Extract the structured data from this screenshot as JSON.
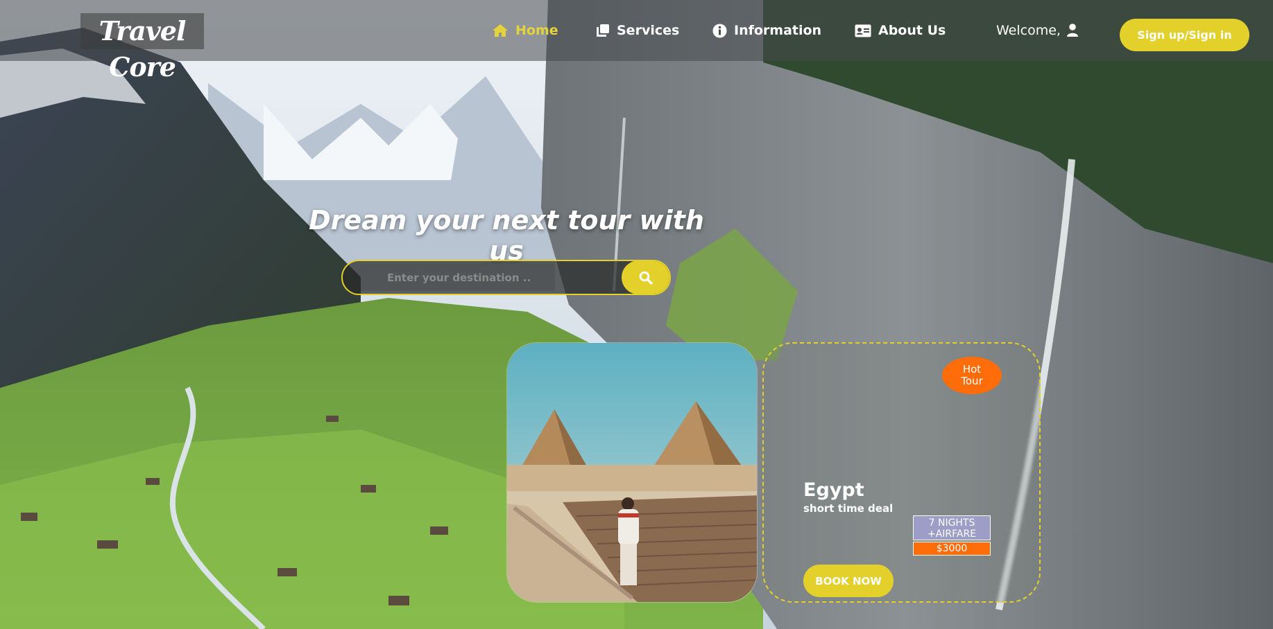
{
  "brand": {
    "logo_text": "Travel Core"
  },
  "nav": {
    "items": [
      {
        "label": "Home",
        "icon": "home-icon",
        "active": true
      },
      {
        "label": "Services",
        "icon": "copy-icon",
        "active": false
      },
      {
        "label": "Information",
        "icon": "info-circle-icon",
        "active": false
      },
      {
        "label": "About Us",
        "icon": "id-card-icon",
        "active": false
      }
    ],
    "welcome_text": "Welcome,",
    "welcome_icon": "user-icon",
    "signup_label": "Sign up/Sign in"
  },
  "hero": {
    "title": "Dream your next tour with us",
    "search": {
      "placeholder": "Enter your destination ..",
      "value": "",
      "button_icon": "search-icon"
    }
  },
  "tour_card": {
    "badge": {
      "line1": "Hot",
      "line2": "Tour"
    },
    "destination": "Egypt",
    "subtitle": "short time deal",
    "package": {
      "line1": "7 NIGHTS",
      "line2": "+AIRFARE"
    },
    "price": "$3000",
    "book_label": "BOOK NOW"
  },
  "colors": {
    "accent": "#e3d02b",
    "hot": "#ff6d0a",
    "package_bg": "#9c9ec8",
    "nav_bg": "rgba(70,72,76,0.55)"
  }
}
